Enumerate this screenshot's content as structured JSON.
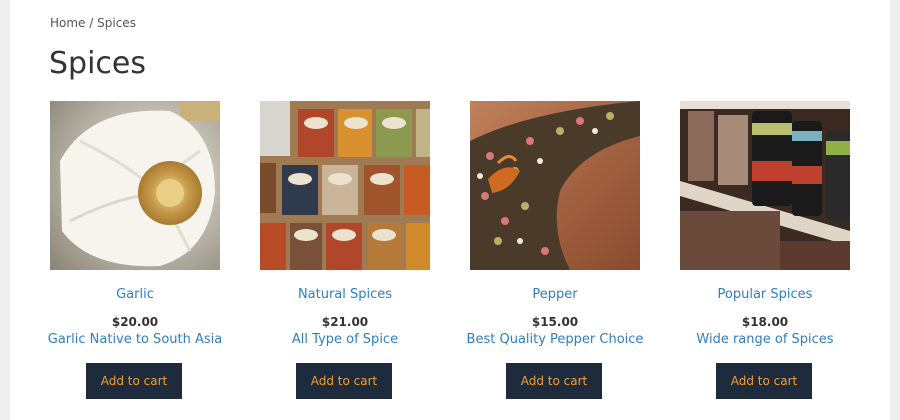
{
  "breadcrumb": {
    "home": "Home",
    "separator": "/",
    "current": "Spices"
  },
  "page_title": "Spices",
  "products": [
    {
      "name": "Garlic",
      "price": "$20.00",
      "description": "Garlic Native to South Asia",
      "button": "Add to cart",
      "image_icon": "garlic-image"
    },
    {
      "name": "Natural Spices",
      "price": "$21.00",
      "description": "All Type of Spice",
      "button": "Add to cart",
      "image_icon": "spice-boxes-image"
    },
    {
      "name": "Pepper",
      "price": "$15.00",
      "description": "Best Quality Pepper Choice",
      "button": "Add to cart",
      "image_icon": "peppercorns-image"
    },
    {
      "name": "Popular Spices",
      "price": "$18.00",
      "description": "Wide range of Spices",
      "button": "Add to cart",
      "image_icon": "spice-shelf-image"
    }
  ],
  "colors": {
    "link": "#2e7fc1",
    "button_bg": "#1e2b3c",
    "button_text": "#f0a030",
    "title": "#333333"
  }
}
